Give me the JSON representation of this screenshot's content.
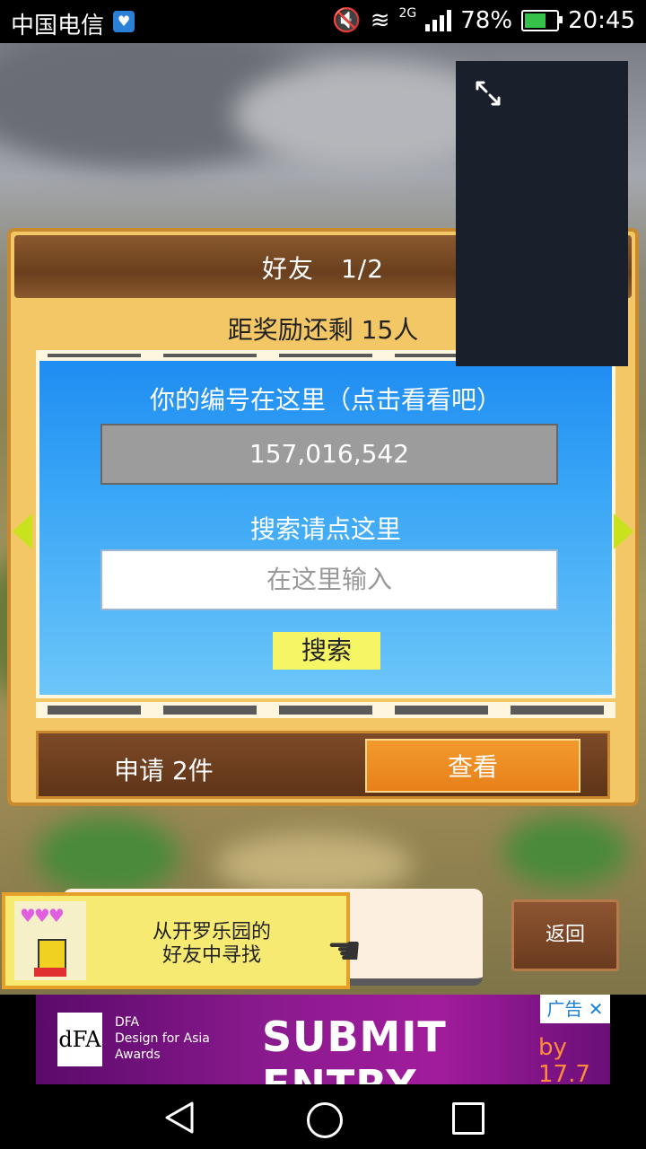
{
  "status_bar": {
    "carrier": "中国电信",
    "battery": "78%",
    "time": "20:45",
    "network": "2G",
    "battery_level": 0.78
  },
  "dialog": {
    "title": "好友",
    "page": "1/2",
    "reward_text": "距奖励还剩 15人",
    "id_label": "你的编号在这里（点击看看吧）",
    "id_value": "157,016,542",
    "search_label": "搜索请点这里",
    "search_placeholder": "在这里输入",
    "search_button": "搜索",
    "request_text": "申请 2件",
    "view_button": "查看"
  },
  "hint": {
    "line1": "从开罗乐园的",
    "line2": "好友中寻找",
    "hearts": "♥♥♥"
  },
  "back_button": "返回",
  "ad": {
    "logo": "dFA",
    "brand_line1": "DFA",
    "brand_line2": "Design for Asia",
    "brand_line3": "Awards",
    "headline": "SUBMIT ENTRY",
    "by": "by 17.7",
    "tag": "广告 ✕"
  },
  "icons": {
    "expand": "expand-icon",
    "pointer": "pointing-hand-icon",
    "nav_back": "back-triangle-icon",
    "nav_home": "home-circle-icon",
    "nav_recent": "recent-square-icon"
  },
  "colors": {
    "panel_blue": "#1f8df2",
    "view_button": "#f29a2e",
    "search_button": "#f6f565",
    "arrows": "#c9e21e"
  }
}
